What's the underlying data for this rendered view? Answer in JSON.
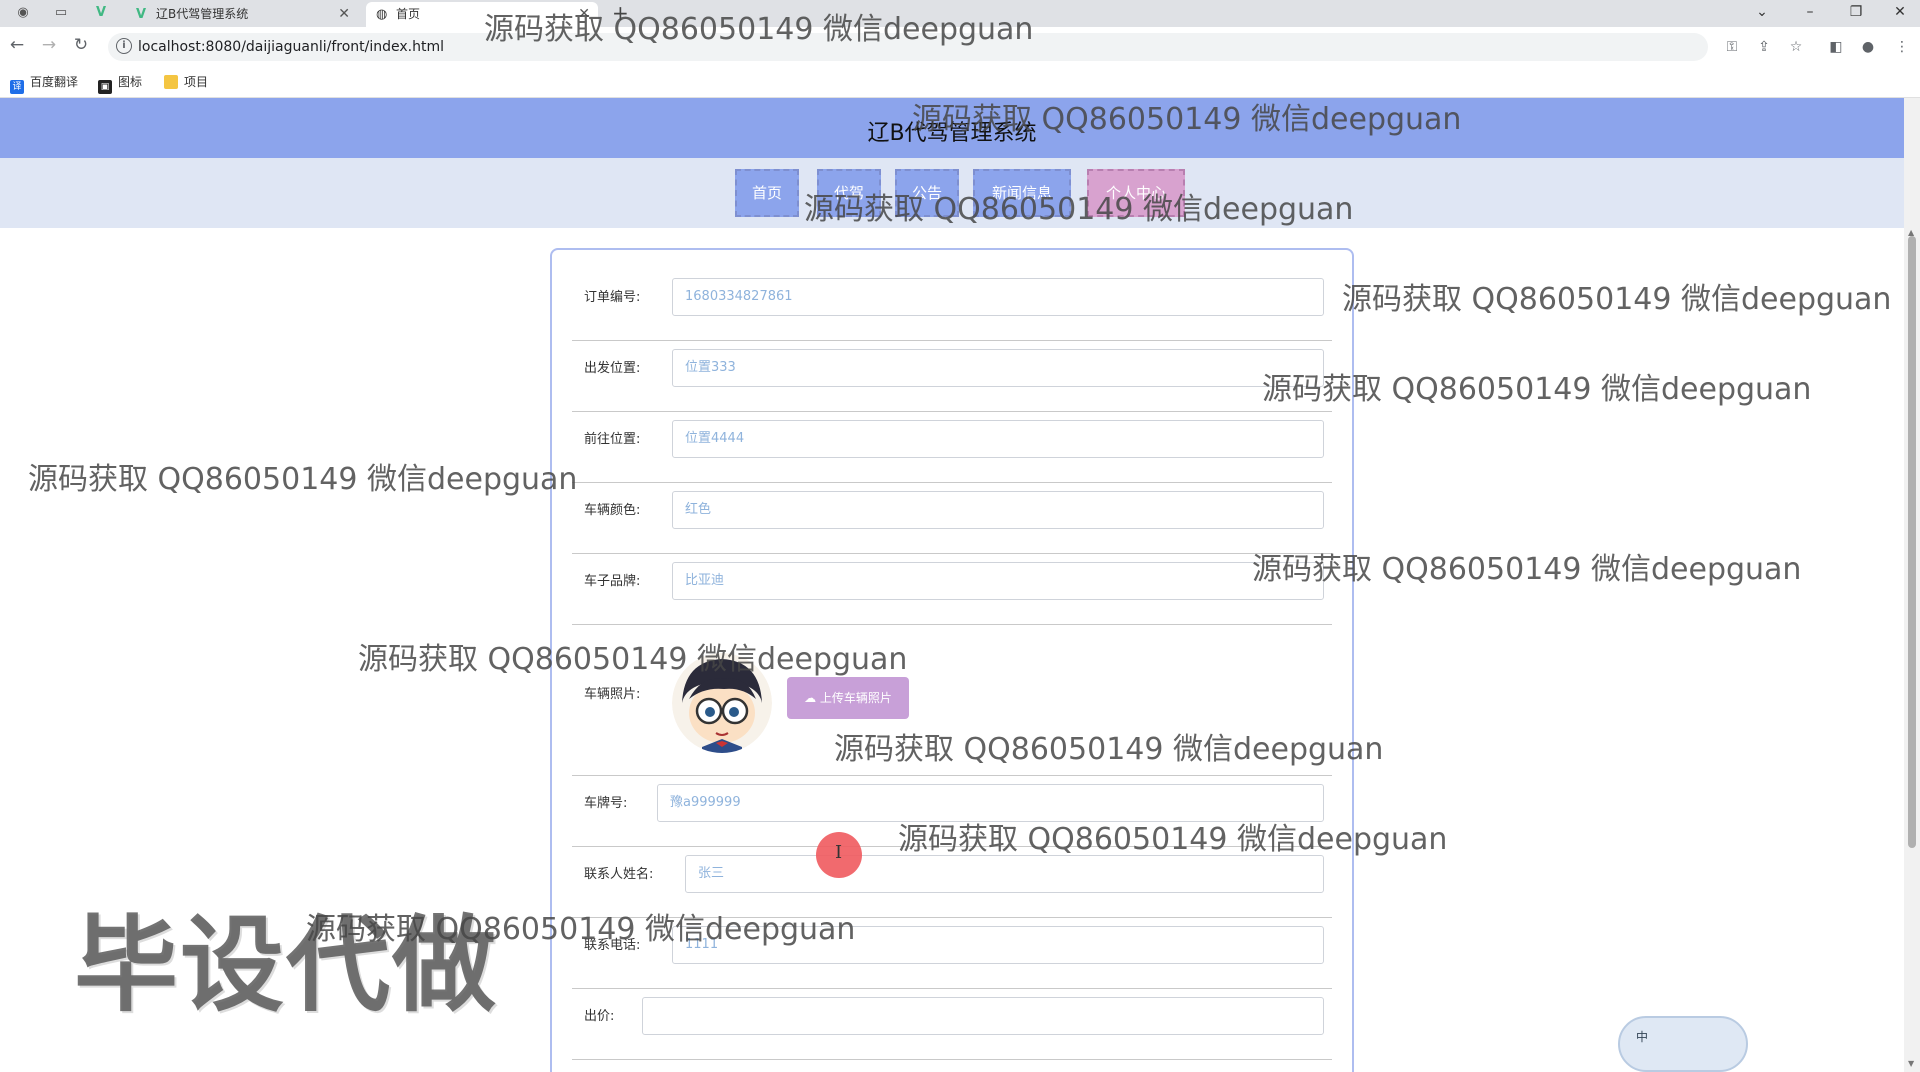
{
  "browser": {
    "tabs": [
      {
        "title": "辽B代驾管理系统",
        "favicon": "vue-icon",
        "active": false
      },
      {
        "title": "首页",
        "favicon": "globe-icon",
        "active": true
      }
    ],
    "url": "localhost:8080/daijiaguanli/front/index.html",
    "bookmarks": [
      {
        "label": "百度翻译",
        "icon": "translate-icon",
        "color": "#1f6ee8"
      },
      {
        "label": "图标",
        "icon": "image-icon",
        "color": "#222222"
      },
      {
        "label": "项目",
        "icon": "folder-icon",
        "color": "#f4c542"
      }
    ]
  },
  "site": {
    "title": "辽B代驾管理系统",
    "nav": [
      {
        "label": "首页"
      },
      {
        "label": "代驾"
      },
      {
        "label": "公告"
      },
      {
        "label": "新闻信息"
      },
      {
        "label": "个人中心"
      }
    ]
  },
  "form": {
    "fields": [
      {
        "label": "订单编号:",
        "value": "1680334827861"
      },
      {
        "label": "出发位置:",
        "value": "位置333"
      },
      {
        "label": "前往位置:",
        "value": "位置4444"
      },
      {
        "label": "车辆颜色:",
        "value": "红色"
      },
      {
        "label": "车子品牌:",
        "value": "比亚迪"
      },
      {
        "label": "车辆照片:",
        "value": ""
      },
      {
        "label": "车牌号:",
        "value": "豫a999999"
      },
      {
        "label": "联系人姓名:",
        "value": "张三"
      },
      {
        "label": "联系电话:",
        "value": "1111"
      },
      {
        "label": "出价:",
        "value": ""
      }
    ],
    "upload_label": "上传车辆照片"
  },
  "ime": {
    "label": "中"
  },
  "watermarks": {
    "text": "源码获取 QQ86050149 微信deepguan",
    "big": "毕设代做"
  },
  "colors": {
    "header": "#8ca4ec",
    "nav_bg": "#dfe6f4",
    "nav_pink": "#d8a2cf",
    "card_border": "#aebdf0",
    "input_text": "#8fb3dc"
  }
}
